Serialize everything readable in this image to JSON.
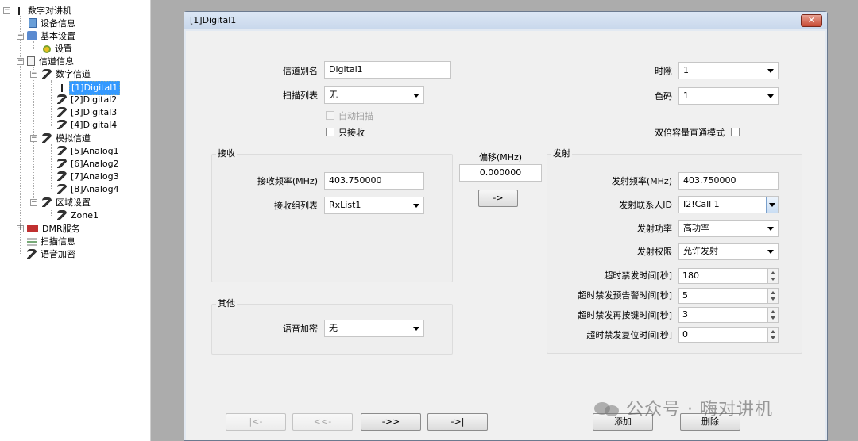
{
  "tree": {
    "root": "数字对讲机",
    "device_info": "设备信息",
    "basic_settings": "基本设置",
    "settings": "设置",
    "channel_info": "信道信息",
    "digital_channel": "数字信道",
    "digital_items": [
      "[1]Digital1",
      "[2]Digital2",
      "[3]Digital3",
      "[4]Digital4"
    ],
    "analog_channel": "模拟信道",
    "analog_items": [
      "[5]Analog1",
      "[6]Analog2",
      "[7]Analog3",
      "[8]Analog4"
    ],
    "zone_settings": "区域设置",
    "zone1": "Zone1",
    "dmr_service": "DMR服务",
    "scan_info": "扫描信息",
    "voice_encrypt": "语音加密"
  },
  "dialog": {
    "title": "[1]Digital1",
    "close_glyph": "✕",
    "channel_alias_label": "信道别名",
    "channel_alias_value": "Digital1",
    "scan_list_label": "扫描列表",
    "scan_list_value": "无",
    "auto_scan_label": "自动扫描",
    "receive_only_label": "只接收",
    "timeslot_label": "时隙",
    "timeslot_value": "1",
    "color_code_label": "色码",
    "color_code_value": "1",
    "dual_capacity_label": "双倍容量直通模式",
    "rx_group": {
      "title": "接收",
      "freq_label": "接收频率(MHz)",
      "freq_value": "403.750000",
      "group_list_label": "接收组列表",
      "group_list_value": "RxList1"
    },
    "offset": {
      "label": "偏移(MHz)",
      "value": "0.000000",
      "button": "->"
    },
    "other_group": {
      "title": "其他",
      "voice_encrypt_label": "语音加密",
      "voice_encrypt_value": "无"
    },
    "tx_group": {
      "title": "发射",
      "freq_label": "发射频率(MHz)",
      "freq_value": "403.750000",
      "contact_label": "发射联系人ID",
      "contact_value": "I2!Call 1",
      "power_label": "发射功率",
      "power_value": "高功率",
      "permission_label": "发射权限",
      "permission_value": "允许发射",
      "tot_label": "超时禁发时间[秒]",
      "tot_value": "180",
      "tot_prealert_label": "超时禁发预告警时间[秒]",
      "tot_prealert_value": "5",
      "tot_rekey_label": "超时禁发再按键时间[秒]",
      "tot_rekey_value": "3",
      "tot_reset_label": "超时禁发复位时间[秒]",
      "tot_reset_value": "0"
    },
    "nav": {
      "first": "|<-",
      "prev": "<<-",
      "next": "->>",
      "last": "->|",
      "add": "添加",
      "delete": "删除"
    }
  },
  "watermark": "公众号 · 嗨对讲机"
}
